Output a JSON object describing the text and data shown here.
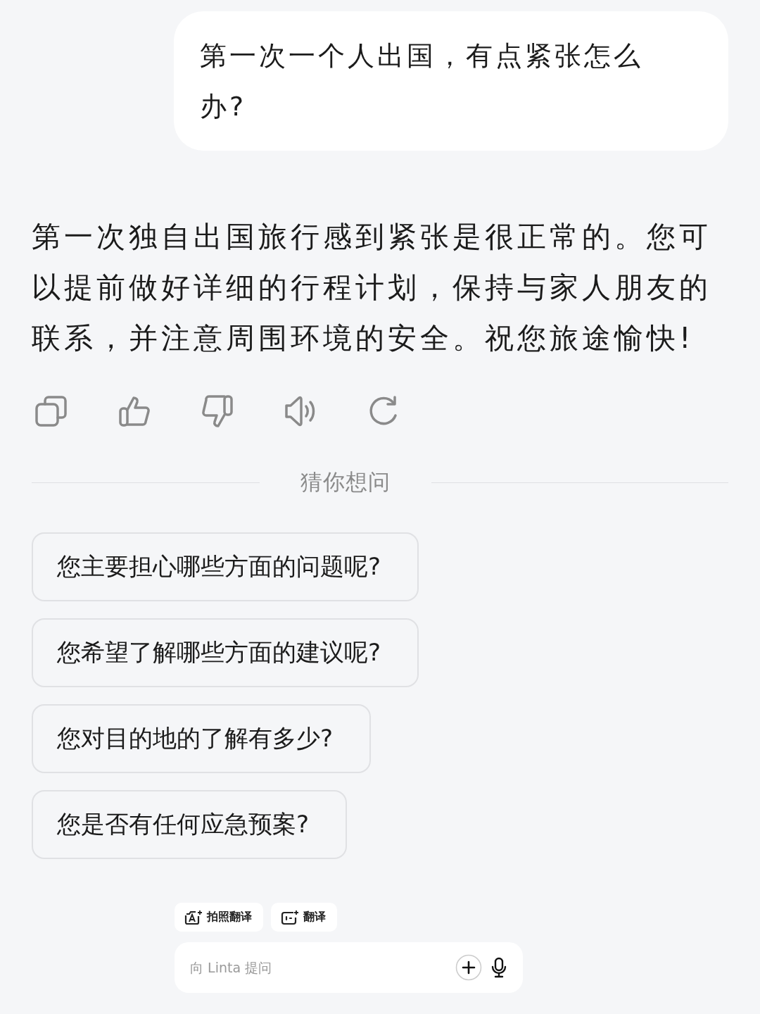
{
  "user_message": "第一次一个人出国，有点紧张怎么办?",
  "reply": "第一次独自出国旅行感到紧张是很正常的。您可以提前做好详细的行程计划，保持与家人朋友的联系，并注意周围环境的安全。祝您旅途愉快!",
  "suggestions_title": "猜你想问",
  "suggestions": [
    "您主要担心哪些方面的问题呢?",
    "您希望了解哪些方面的建议呢?",
    "您对目的地的了解有多少?",
    "您是否有任何应急预案?"
  ],
  "quick_actions": [
    {
      "kind": "photo",
      "label": "拍照翻译"
    },
    {
      "kind": "translate",
      "label": "翻译"
    }
  ],
  "composer": {
    "placeholder": "向 Linta 提问"
  }
}
